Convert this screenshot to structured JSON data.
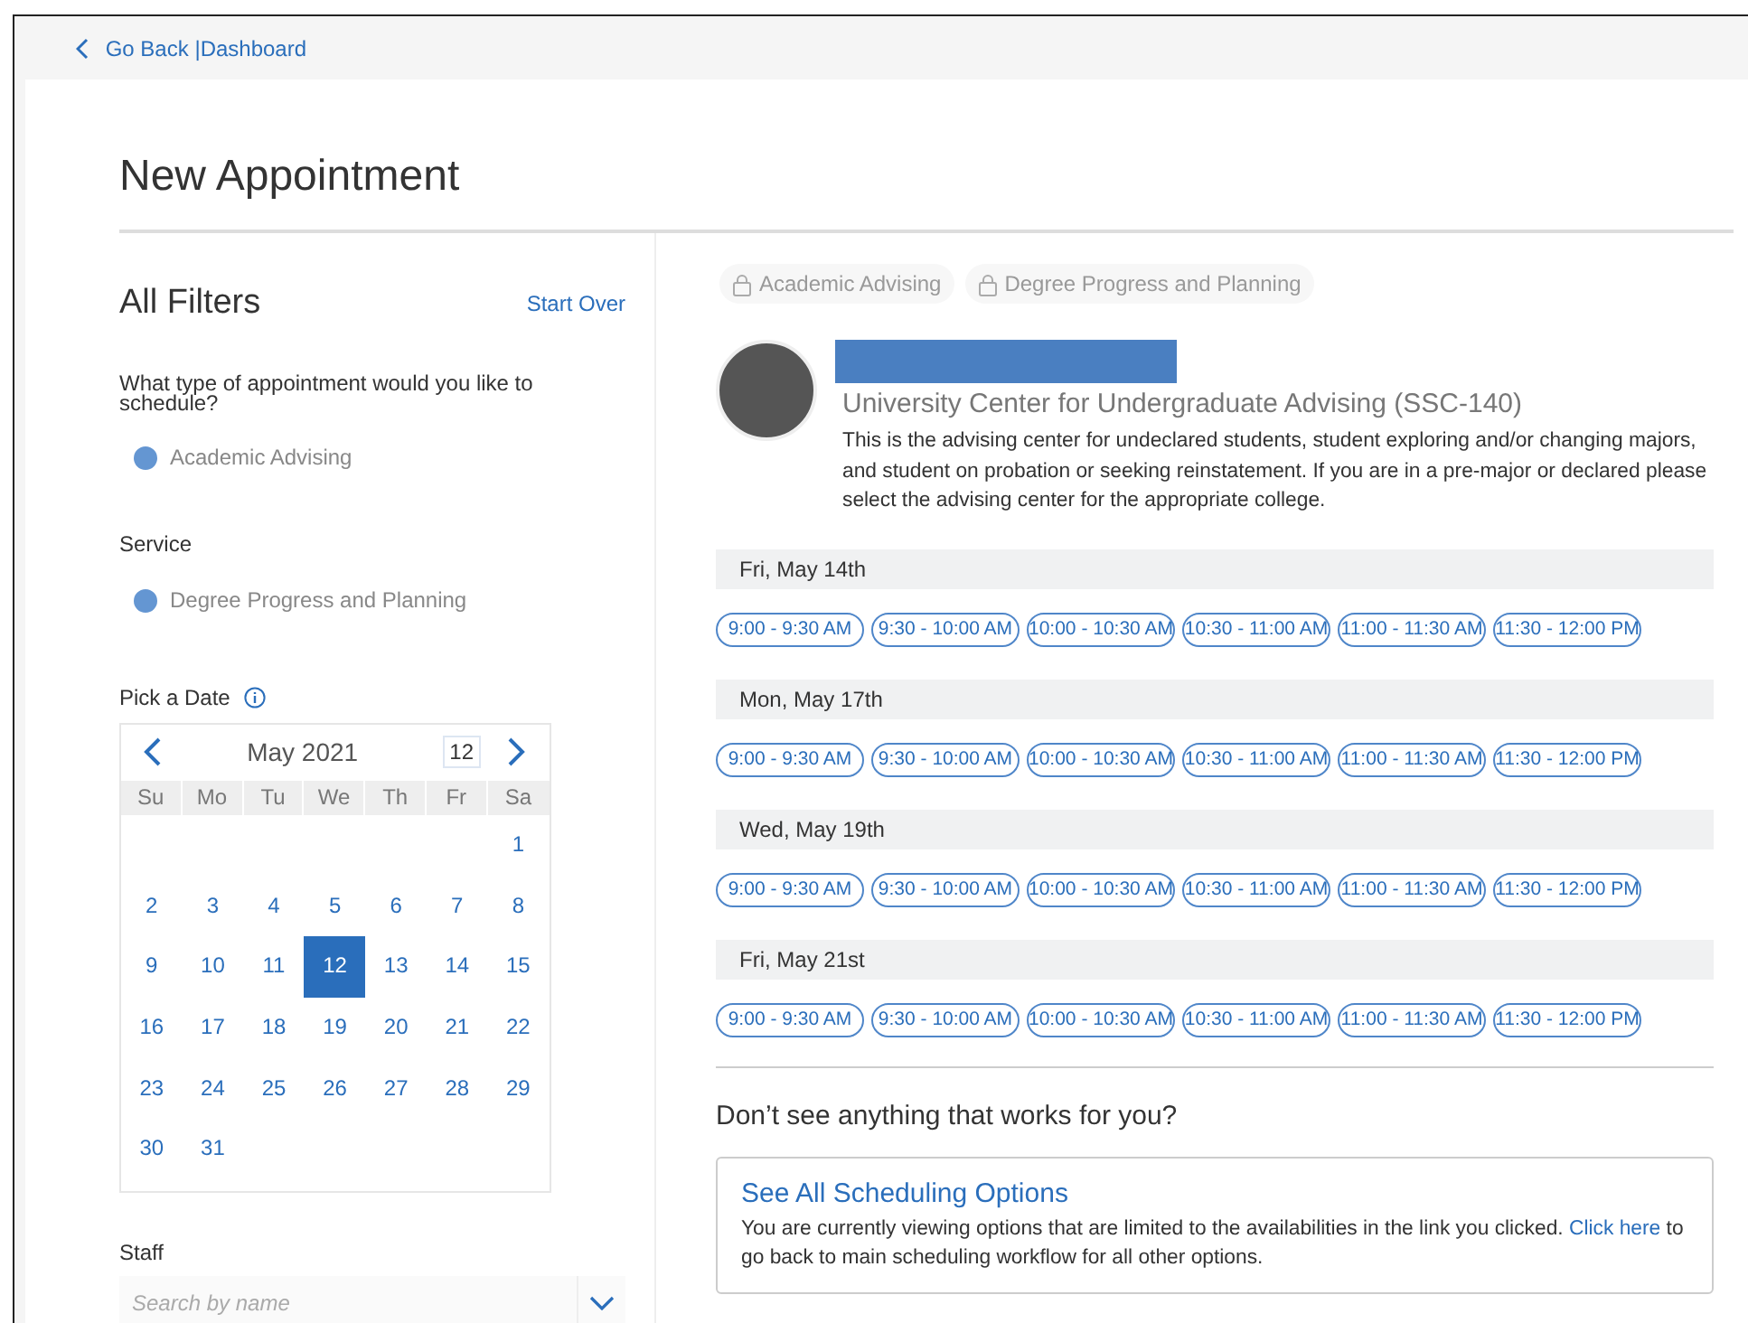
{
  "nav": {
    "back_link": "Go Back |",
    "dashboard_link": "Dashboard"
  },
  "page_title": "New Appointment",
  "filters": {
    "title": "All Filters",
    "start_over": "Start Over",
    "appointment_type": {
      "label": "What type of appointment would you like to schedule?",
      "options": [
        {
          "label": "Academic Advising",
          "selected": true
        }
      ]
    },
    "service": {
      "label": "Service",
      "options": [
        {
          "label": "Degree Progress and Planning",
          "selected": true
        }
      ]
    },
    "date": {
      "label": "Pick a Date",
      "calendar": {
        "month": "May 2021",
        "day_input": "12",
        "weekdays": [
          "Su",
          "Mo",
          "Tu",
          "We",
          "Th",
          "Fr",
          "Sa"
        ],
        "weeks": [
          [
            {
              "kind": "blank"
            },
            {
              "kind": "blank"
            },
            {
              "kind": "blank"
            },
            {
              "kind": "blank"
            },
            {
              "kind": "blank"
            },
            {
              "kind": "blank"
            },
            {
              "kind": "day",
              "day": "1",
              "selected": false
            }
          ],
          [
            {
              "kind": "day",
              "day": "2",
              "selected": false
            },
            {
              "kind": "day",
              "day": "3",
              "selected": false
            },
            {
              "kind": "day",
              "day": "4",
              "selected": false
            },
            {
              "kind": "day",
              "day": "5",
              "selected": false
            },
            {
              "kind": "day",
              "day": "6",
              "selected": false
            },
            {
              "kind": "day",
              "day": "7",
              "selected": false
            },
            {
              "kind": "day",
              "day": "8",
              "selected": false
            }
          ],
          [
            {
              "kind": "day",
              "day": "9",
              "selected": false
            },
            {
              "kind": "day",
              "day": "10",
              "selected": false
            },
            {
              "kind": "day",
              "day": "11",
              "selected": false
            },
            {
              "kind": "day",
              "day": "12",
              "selected": true
            },
            {
              "kind": "day",
              "day": "13",
              "selected": false
            },
            {
              "kind": "day",
              "day": "14",
              "selected": false
            },
            {
              "kind": "day",
              "day": "15",
              "selected": false
            }
          ],
          [
            {
              "kind": "day",
              "day": "16",
              "selected": false
            },
            {
              "kind": "day",
              "day": "17",
              "selected": false
            },
            {
              "kind": "day",
              "day": "18",
              "selected": false
            },
            {
              "kind": "day",
              "day": "19",
              "selected": false
            },
            {
              "kind": "day",
              "day": "20",
              "selected": false
            },
            {
              "kind": "day",
              "day": "21",
              "selected": false
            },
            {
              "kind": "day",
              "day": "22",
              "selected": false
            }
          ],
          [
            {
              "kind": "day",
              "day": "23",
              "selected": false
            },
            {
              "kind": "day",
              "day": "24",
              "selected": false
            },
            {
              "kind": "day",
              "day": "25",
              "selected": false
            },
            {
              "kind": "day",
              "day": "26",
              "selected": false
            },
            {
              "kind": "day",
              "day": "27",
              "selected": false
            },
            {
              "kind": "day",
              "day": "28",
              "selected": false
            },
            {
              "kind": "day",
              "day": "29",
              "selected": false
            }
          ],
          [
            {
              "kind": "day",
              "day": "30",
              "selected": false
            },
            {
              "kind": "day",
              "day": "31",
              "selected": false
            },
            {
              "kind": "blank"
            },
            {
              "kind": "blank"
            },
            {
              "kind": "blank"
            },
            {
              "kind": "blank"
            },
            {
              "kind": "blank"
            }
          ]
        ]
      }
    },
    "staff": {
      "label": "Staff",
      "placeholder": "Search by name"
    }
  },
  "chips": [
    "Academic Advising",
    "Degree Progress and Planning"
  ],
  "location": {
    "name": "University Center for Undergraduate Advising (SSC-140)",
    "description": "This is the advising center for undeclared students, student exploring and/or changing majors, and student on probation or seeking reinstatement. If you are in a pre-major or declared please select the advising center for the appropriate college."
  },
  "days": [
    {
      "date": "Fri, May 14th",
      "slots": [
        "9:00 - 9:30 AM",
        "9:30 - 10:00 AM",
        "10:00 - 10:30 AM",
        "10:30 - 11:00 AM",
        "11:00 - 11:30 AM",
        "11:30 - 12:00 PM"
      ]
    },
    {
      "date": "Mon, May 17th",
      "slots": [
        "9:00 - 9:30 AM",
        "9:30 - 10:00 AM",
        "10:00 - 10:30 AM",
        "10:30 - 11:00 AM",
        "11:00 - 11:30 AM",
        "11:30 - 12:00 PM"
      ]
    },
    {
      "date": "Wed, May 19th",
      "slots": [
        "9:00 - 9:30 AM",
        "9:30 - 10:00 AM",
        "10:00 - 10:30 AM",
        "10:30 - 11:00 AM",
        "11:00 - 11:30 AM",
        "11:30 - 12:00 PM"
      ]
    },
    {
      "date": "Fri, May 21st",
      "slots": [
        "9:00 - 9:30 AM",
        "9:30 - 10:00 AM",
        "10:00 - 10:30 AM",
        "10:30 - 11:00 AM",
        "11:00 - 11:30 AM",
        "11:30 - 12:00 PM"
      ]
    }
  ],
  "more_options": {
    "question": "Don’t see anything that works for you?",
    "title": "See All Scheduling Options",
    "text_before": "You are currently viewing options that are limited to the availabilities in the link you clicked.",
    "link": "Click here",
    "text_after": "to go back to main scheduling workflow for all other options."
  }
}
